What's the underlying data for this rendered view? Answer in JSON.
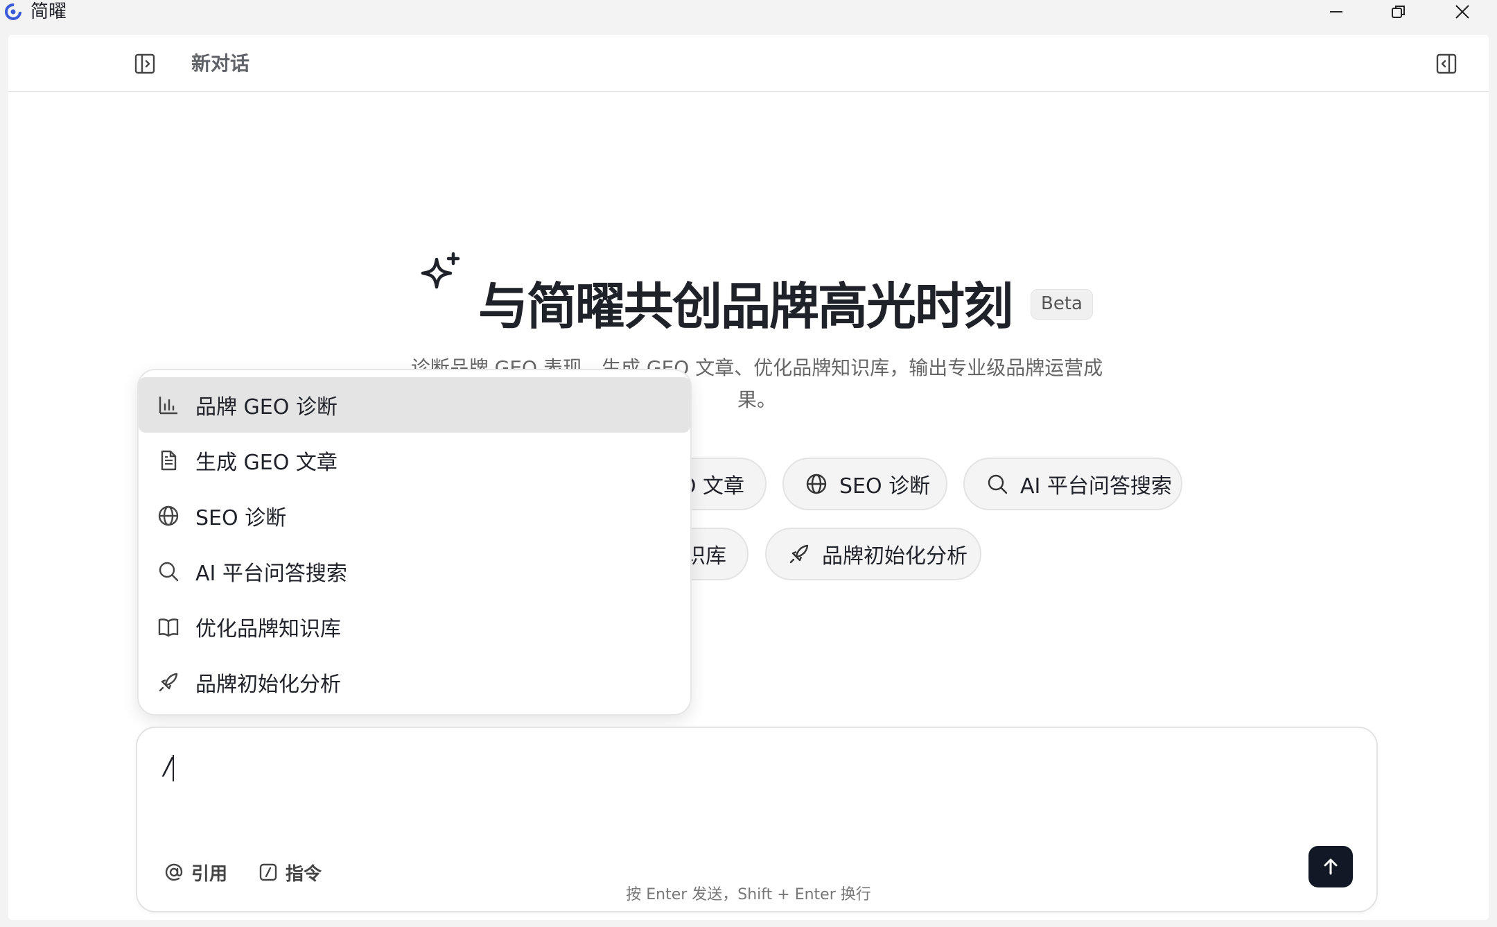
{
  "window": {
    "title": "简曜"
  },
  "header": {
    "chat_title": "新对话"
  },
  "hero": {
    "title": "与简曜共创品牌高光时刻",
    "badge": "Beta",
    "subtitle": "诊断品牌 GEO 表现、生成 GEO 文章、优化品牌知识库，输出专业级品牌运营成果。"
  },
  "chips": [
    {
      "label": "生成 GEO 文章",
      "icon": "file-icon"
    },
    {
      "label": "SEO 诊断",
      "icon": "globe-icon"
    },
    {
      "label": "AI 平台问答搜索",
      "icon": "search-icon"
    },
    {
      "label": "优化品牌知识库",
      "icon": "book-icon"
    },
    {
      "label": "品牌初始化分析",
      "icon": "rocket-icon"
    }
  ],
  "chips_visible": {
    "geo_article_tail": "O 文章",
    "kb_tail": "识库"
  },
  "dropdown": {
    "items": [
      {
        "label": "品牌 GEO 诊断",
        "icon": "bar-chart-icon",
        "active": true
      },
      {
        "label": "生成 GEO 文章",
        "icon": "file-icon"
      },
      {
        "label": "SEO 诊断",
        "icon": "globe-icon"
      },
      {
        "label": "AI 平台问答搜索",
        "icon": "search-icon"
      },
      {
        "label": "优化品牌知识库",
        "icon": "book-icon"
      },
      {
        "label": "品牌初始化分析",
        "icon": "rocket-icon"
      }
    ]
  },
  "composer": {
    "value": "/",
    "cite_label": "引用",
    "command_label": "指令",
    "hint": "按 Enter 发送，Shift + Enter 换行"
  }
}
